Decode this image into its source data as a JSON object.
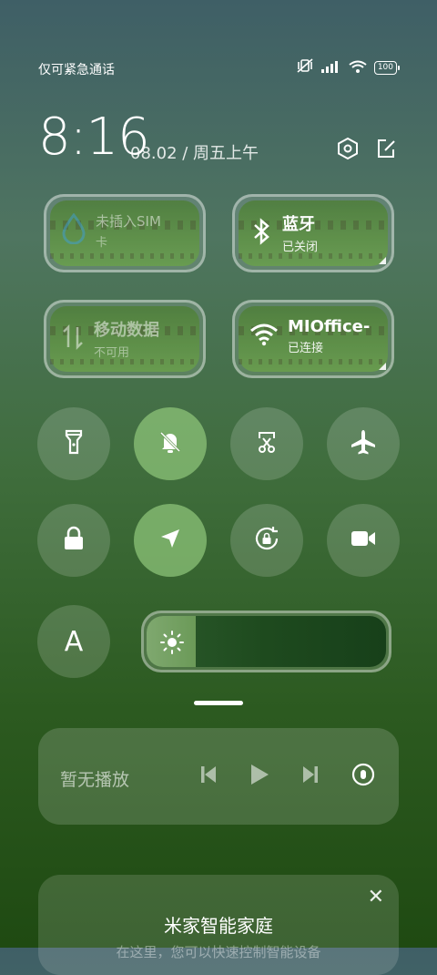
{
  "status": {
    "carrier_text": "仅可紧急通话",
    "battery": "100"
  },
  "clock": {
    "time": "8:16",
    "date": "08.02 / 周五上午"
  },
  "tiles": [
    {
      "title": "未插入SIM",
      "subtitle": "卡",
      "state": "disabled"
    },
    {
      "title": "蓝牙",
      "subtitle": "已关闭",
      "state": "off"
    },
    {
      "title": "移动数据",
      "subtitle": "不可用",
      "state": "disabled"
    },
    {
      "title": "MIOffice-",
      "subtitle": "已连接",
      "state": "on"
    }
  ],
  "toggles_row1": [
    "flashlight-icon",
    "mute-bell-icon",
    "screenshot-icon",
    "airplane-icon"
  ],
  "toggles_row2": [
    "lock-icon",
    "location-icon",
    "rotation-lock-icon",
    "video-icon"
  ],
  "auto_brightness_label": "A",
  "brightness_level": 0.2,
  "media": {
    "status": "暂无播放"
  },
  "smarthome": {
    "title": "米家智能家庭",
    "subtitle": "在这里，您可以快速控制智能设备"
  },
  "colors": {
    "accent_active": "#8cc378"
  }
}
